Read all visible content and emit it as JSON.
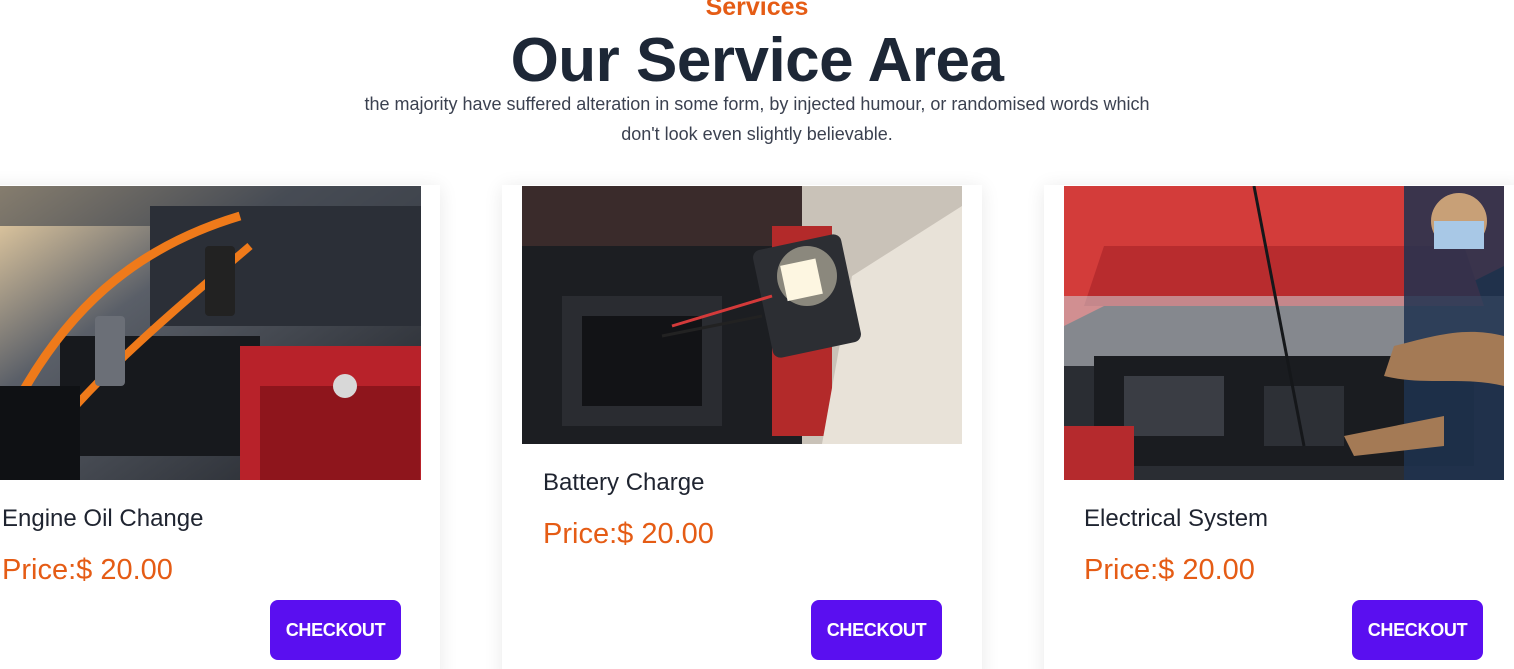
{
  "section": {
    "eyebrow": "Services",
    "title": "Our Service Area",
    "description": "the majority have suffered alteration in some form, by injected humour, or randomised words which don't look even slightly believable."
  },
  "services": [
    {
      "title": "Engine Oil Change",
      "price": "Price:$ 20.00",
      "button": "CHECKOUT",
      "image": "engine-jumper-cables-photo"
    },
    {
      "title": "Battery Charge",
      "price": "Price:$ 20.00",
      "button": "CHECKOUT",
      "image": "battery-tester-photo"
    },
    {
      "title": "Electrical System",
      "price": "Price:$ 20.00",
      "button": "CHECKOUT",
      "image": "mechanic-open-hood-photo"
    }
  ],
  "colors": {
    "accent": "#e55c15",
    "button": "#5a0ff0",
    "heading": "#1d2736"
  }
}
